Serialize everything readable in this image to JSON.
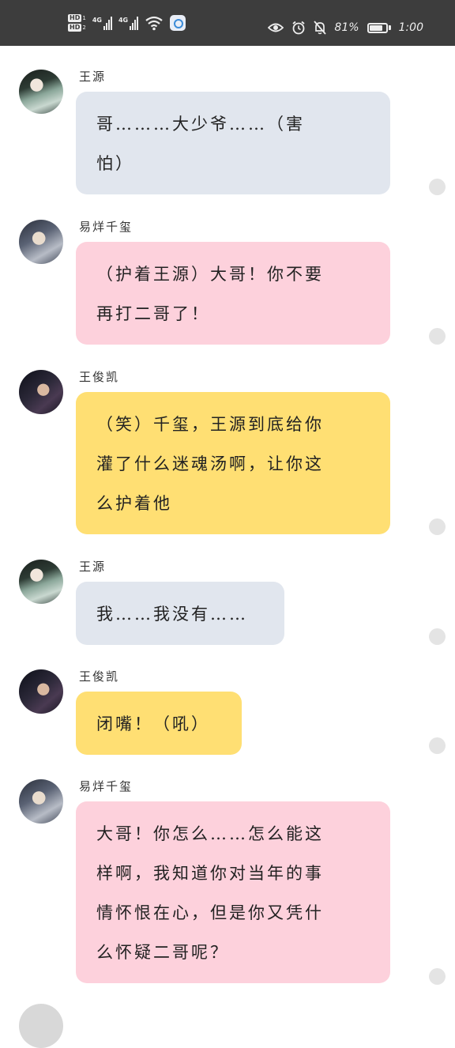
{
  "status_bar": {
    "hd1": "HD",
    "hd1_num": "1",
    "hd2": "HD",
    "hd2_num": "2",
    "net1": "4G",
    "net2": "4G",
    "battery_percent_text": "81%",
    "battery_level": 0.81,
    "time": "1:00",
    "icons": [
      "eye-icon",
      "alarm-icon",
      "bell-off-icon",
      "battery-icon",
      "wifi-icon",
      "signal-icon"
    ]
  },
  "colors": {
    "status_bar_bg": "#3d3d3d",
    "bubble_blue": "#e1e6ee",
    "bubble_pink": "#fdd1dc",
    "bubble_yellow": "#ffdf73"
  },
  "messages": [
    {
      "sender": "王源",
      "avatar": "avatar-wangyuan",
      "color": "blue",
      "lines": [
        "哥………大少爷……（害",
        "怕）"
      ]
    },
    {
      "sender": "易烊千玺",
      "avatar": "avatar-yiyangqianxi",
      "color": "pink",
      "lines": [
        "（护着王源）大哥！你不要",
        "再打二哥了！"
      ]
    },
    {
      "sender": "王俊凯",
      "avatar": "avatar-wangjunkai",
      "color": "yellow",
      "lines": [
        "（笑）千玺，王源到底给你",
        "灌了什么迷魂汤啊，让你这",
        "么护着他"
      ]
    },
    {
      "sender": "王源",
      "avatar": "avatar-wangyuan",
      "color": "blue",
      "lines": [
        "我……我没有……"
      ]
    },
    {
      "sender": "王俊凯",
      "avatar": "avatar-wangjunkai",
      "color": "yellow",
      "lines": [
        "闭嘴！（吼）"
      ]
    },
    {
      "sender": "易烊千玺",
      "avatar": "avatar-yiyangqianxi",
      "color": "pink",
      "lines": [
        "大哥！你怎么……怎么能这",
        "样啊，我知道你对当年的事",
        "情怀恨在心，但是你又凭什",
        "么怀疑二哥呢？"
      ]
    }
  ]
}
